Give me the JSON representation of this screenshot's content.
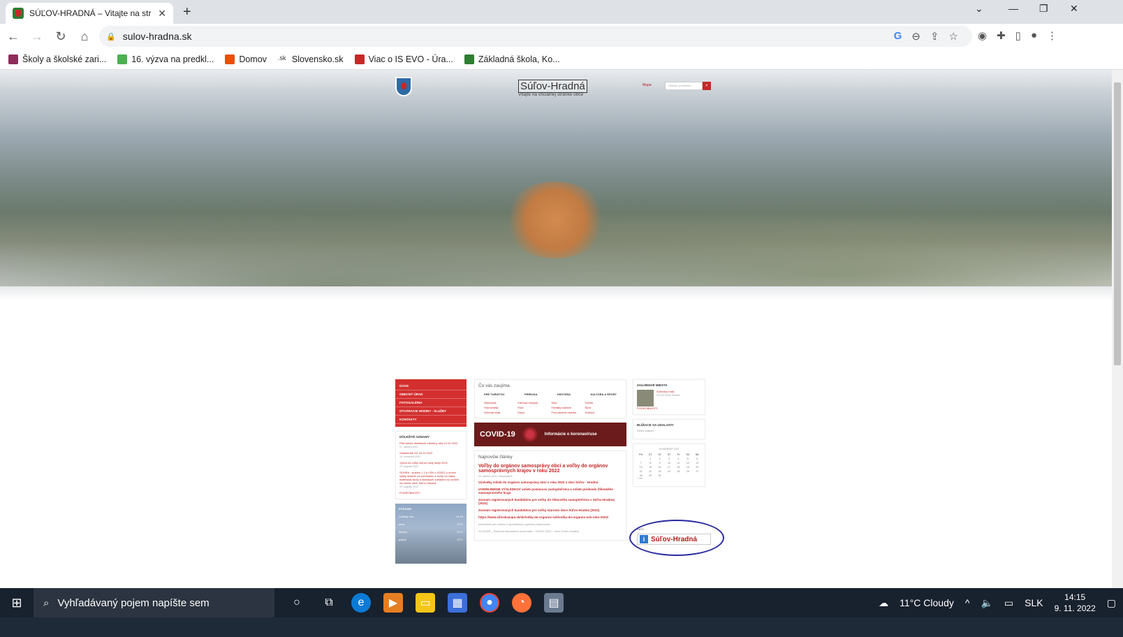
{
  "browser": {
    "tab_title": "SÚĽOV-HRADNÁ – Vitajte na str",
    "new_tab": "+",
    "url": "sulov-hradna.sk",
    "bookmarks": [
      {
        "label": "Školy a školské zari..."
      },
      {
        "label": "16. výzva na predkl..."
      },
      {
        "label": "Domov"
      },
      {
        "label": "Slovensko.sk"
      },
      {
        "label": "Viac o IS EVO - Úra..."
      },
      {
        "label": "Základná škola, Ko..."
      }
    ]
  },
  "site": {
    "title": "Súľov-Hradná",
    "subtitle": "Vitajte na oficiálnej stránke obce",
    "map_label": "Mapa",
    "search_placeholder": "Hľadať na stránke...",
    "menu": [
      "ÚVOD",
      "OBECNÝ ÚRAD",
      "FOTOGALÉRIA",
      "OTVÁRACIE HODINY - SLUŽBY",
      "KONTAKTY"
    ],
    "notices": {
      "title": "DÔLEŽITÉ OZNAMY",
      "items": [
        {
          "text": "Prerušenie distribúcie elektriny dňa 24.10.2022",
          "date": "17. októbra 2022"
        },
        {
          "text": "Zasadnutie OZ 18.11.2022",
          "date": "15. novembra 2022"
        },
        {
          "text": "Výzva na voľby členov rady školy 2022",
          "date": "29. augusta 2022"
        },
        {
          "text": "SOHRA - služieb 1.2 a VZN č.3/2022 o určení výšky dotácie na prevádzku a mzdy na žiaka materskej školy a školských zariadení so sídlom na území obce Súľov-Hradná",
          "date": "15. augusta 2022"
        }
      ],
      "more": "PODROBNOSTI"
    },
    "weather": {
      "title": "POČASIE",
      "rows": [
        {
          "place": "Lokálny čas",
          "val": "14:15"
        },
        {
          "place": "dnes",
          "val": "12°C"
        },
        {
          "place": "štvrtok",
          "val": "10°C"
        },
        {
          "place": "piatok",
          "val": "12°C"
        }
      ]
    },
    "interest": {
      "title": "Čo vás zaujíma",
      "cats": [
        "PRE TURISTOV",
        "PRÍRODA",
        "HISTÓRIA",
        "KULTÚRA A ŠPORT"
      ],
      "links": [
        "Ubytovanie",
        "Súľovský vodopád",
        "Obec",
        "Kultúra",
        "Hrad turistika",
        "Flóra",
        "Pamiatky súčasné",
        "Šport",
        "Súľovské skaly",
        "Fauna",
        "Prvá písomná zmienka",
        "Knižnica"
      ]
    },
    "covid": {
      "big": "COVID-19",
      "small": "Informácie o koronavíruse"
    },
    "news": {
      "title": "Najnovšie články",
      "main": "Voľby do orgánov samosprávy obcí a voľby do orgánov samosprávnych krajov v roku 2022",
      "date": "25. októbra 2022 • Nezaradené",
      "items": [
        "Výsledky volieb do orgánov samosprávy obcí v roku 2022 v obci Súľov - Hradná",
        "UVEREJNENIE VÝSLEDKOV volieb poslancov zastupiteľstva a volieb predsedu Žilinského samosprávneho kraja",
        "Zoznam registrovaných kandidátov pre voľby do Obecného zastupiteľstva v Súľov-Hradnej (2022)",
        "Zoznam registrovaných kandidátov pre voľby starostu obce Súľov-Hradná (2022)",
        "https://www.zilinskazupa.sk/sk/volby-do-organov-ozk/volby-do-organov-ozk-roku-2022/"
      ],
      "plain": [
        "Informácie pre voličov k špeciálnemu spôsobu hlasovania",
        "10-SOHR – Súhrnné informačné povinnosti – VOĽBY 2022 – obec Súľov-Hradná"
      ]
    },
    "places": {
      "title": "ZAUJÍMAVÉ MIESTA",
      "name": "Súľovský hrad",
      "sub": "013 52 Súľov-Hradná",
      "more": "PODROBNOSTI"
    },
    "events": {
      "title": "BLÍŽIACE SA UDALOSTI",
      "empty": "Žiadne udalosti"
    },
    "calendar": {
      "month": "NOVEMBER 2022",
      "days": [
        "PO",
        "UT",
        "ST",
        "ŠT",
        "PI",
        "SO",
        "NE"
      ],
      "dates": [
        "",
        "1",
        "2",
        "3",
        "4",
        "5",
        "6",
        "7",
        "8",
        "9",
        "10",
        "11",
        "12",
        "13",
        "14",
        "15",
        "16",
        "17",
        "18",
        "19",
        "20",
        "21",
        "22",
        "23",
        "24",
        "25",
        "26",
        "27",
        "28",
        "29",
        "30",
        "",
        "",
        "",
        ""
      ],
      "prev": "« okt"
    },
    "info": {
      "label": "INFO",
      "badge": "Súľov-Hradná"
    }
  },
  "taskbar": {
    "search": "Vyhľadávaný pojem napíšte sem",
    "weather": "11°C  Cloudy",
    "lang": "SLK",
    "time": "14:15",
    "date": "9. 11. 2022"
  }
}
